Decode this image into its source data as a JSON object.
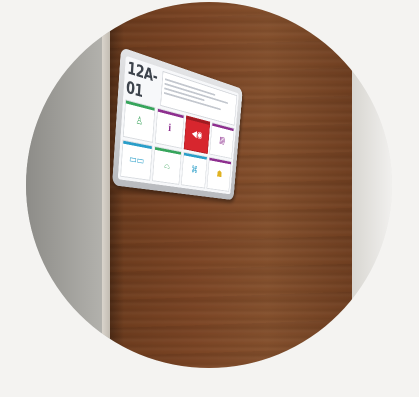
{
  "panel": {
    "room_number": "12A-01"
  },
  "tiles": [
    {
      "icon": "person-icon",
      "glyph": "♙",
      "accent": "#37a55c",
      "kind": "green"
    },
    {
      "icon": "info-icon",
      "glyph": "ℹ",
      "accent": "#8e2f8f",
      "kind": "purple"
    },
    {
      "icon": "alarm-icon",
      "glyph": "◀◉",
      "accent": "#d7262e",
      "kind": "active"
    },
    {
      "icon": "document-icon",
      "glyph": "▤",
      "accent": "#8e2f8f",
      "kind": "purple"
    },
    {
      "icon": "bed-icon",
      "glyph": "▭▭",
      "accent": "#2a9ec9",
      "kind": "cyan"
    },
    {
      "icon": "toilet-icon",
      "glyph": "⌓",
      "accent": "#37a55c",
      "kind": "green"
    },
    {
      "icon": "meal-icon",
      "glyph": "⌘",
      "accent": "#2a9ec9",
      "kind": "cyan"
    },
    {
      "icon": "basket-icon",
      "glyph": "☗",
      "accent": "#8e2f8f",
      "kind": "yellow"
    }
  ],
  "colors": {
    "door_wood": "#7b4525",
    "alarm_red": "#d7262e"
  }
}
